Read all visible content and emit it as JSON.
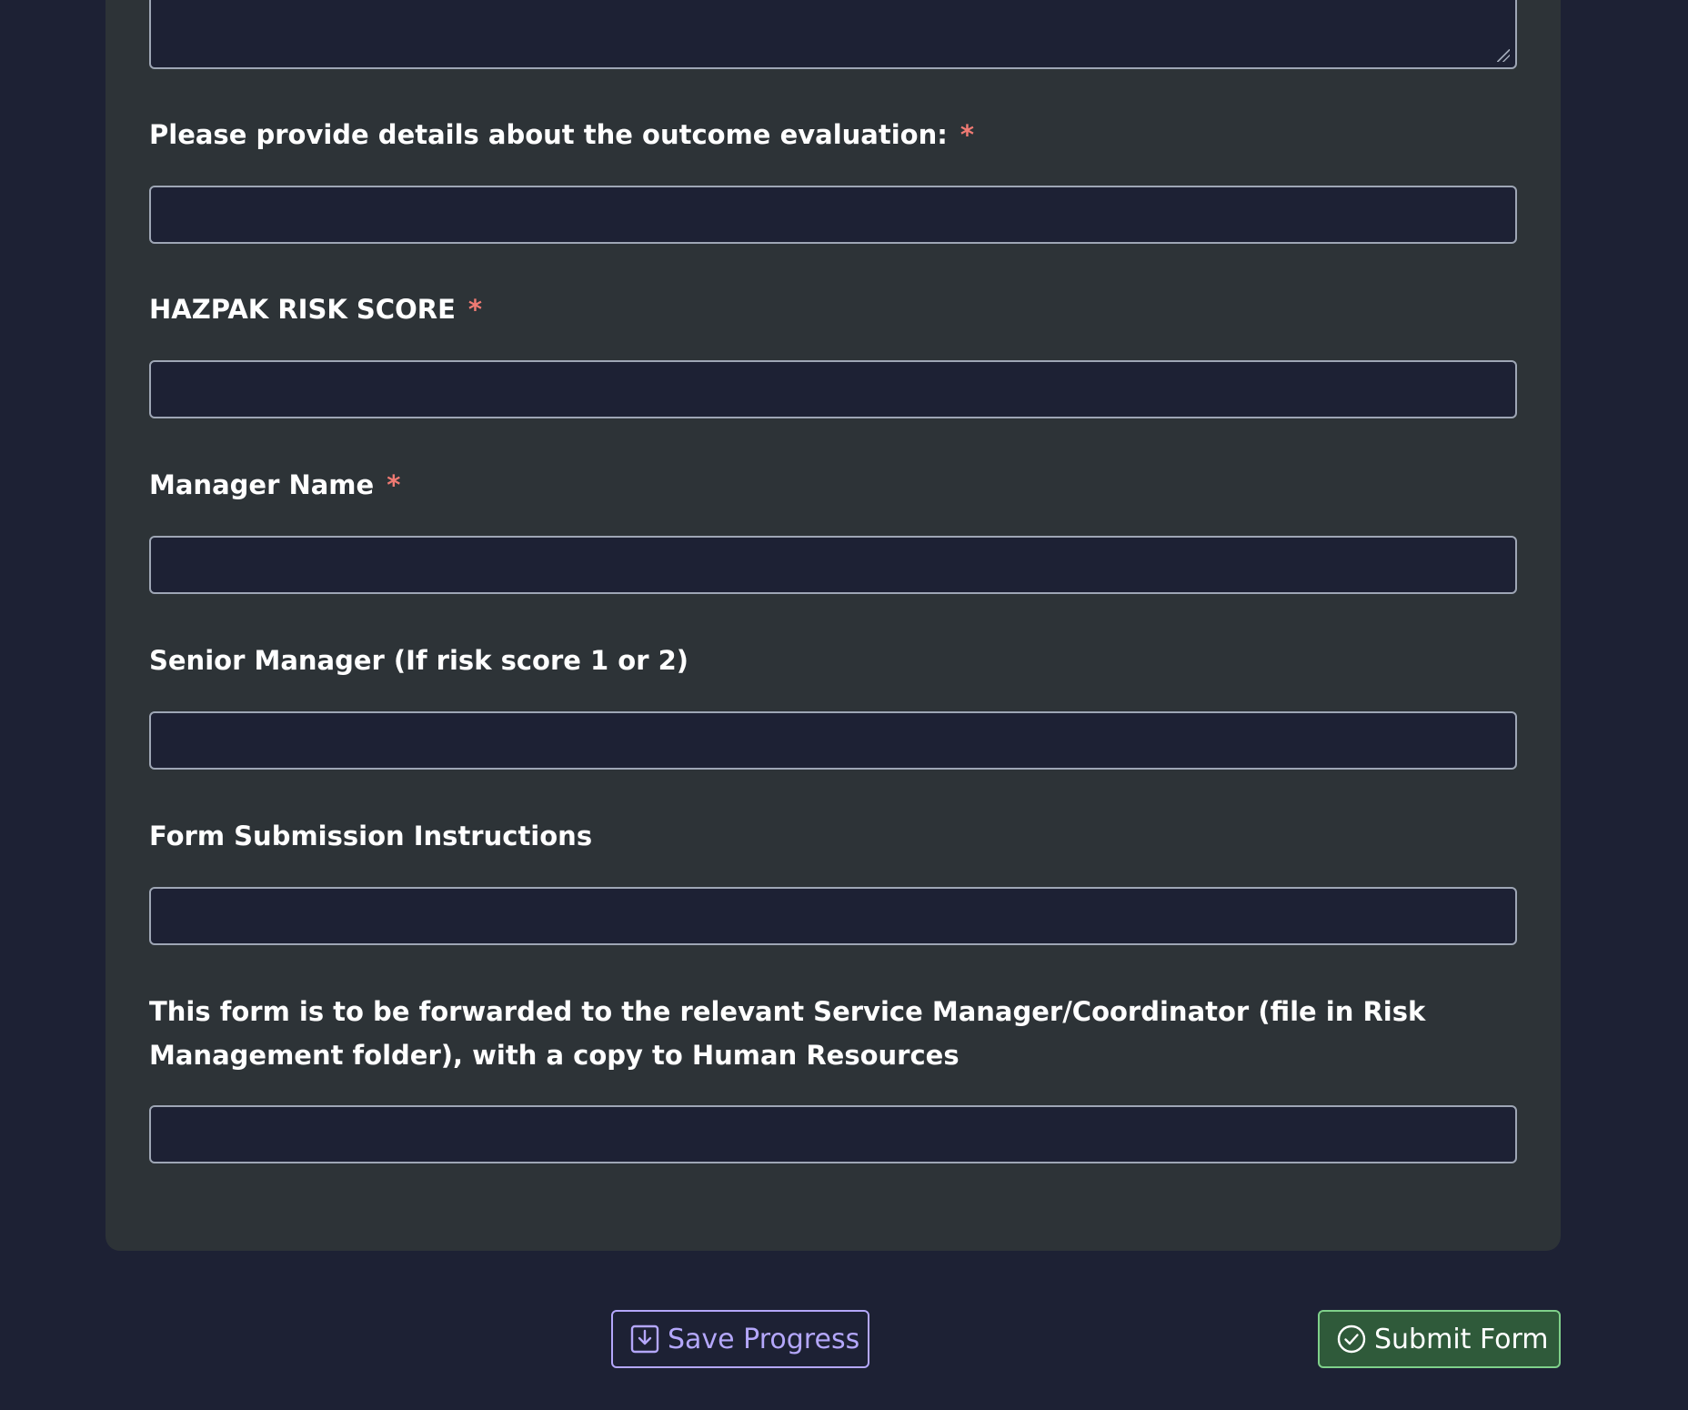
{
  "form": {
    "fields": [
      {
        "label": "Please provide details about the outcome evaluation:",
        "required_mark": "*",
        "value": ""
      },
      {
        "label": "HAZPAK RISK SCORE",
        "required_mark": "*",
        "value": ""
      },
      {
        "label": "Manager Name",
        "required_mark": "*",
        "value": ""
      },
      {
        "label": "Senior Manager (If risk score 1 or 2)",
        "value": ""
      },
      {
        "label": "Form Submission Instructions",
        "value": ""
      },
      {
        "label": "This form is to be forwarded to the relevant Service Manager/Coordinator (file in Risk Management folder), with a copy to Human Resources",
        "value": ""
      }
    ]
  },
  "actions": {
    "save_label": "Save Progress",
    "save_icon": "save-download-icon",
    "submit_label": "Submit Form",
    "submit_icon": "check-circle-icon"
  },
  "colors": {
    "background": "#1d2134",
    "card": "#2d3337",
    "required": "#f07a73",
    "save_accent": "#b4a7fb",
    "submit_accent": "#7fd08a",
    "submit_bg": "#2f5a3a"
  }
}
